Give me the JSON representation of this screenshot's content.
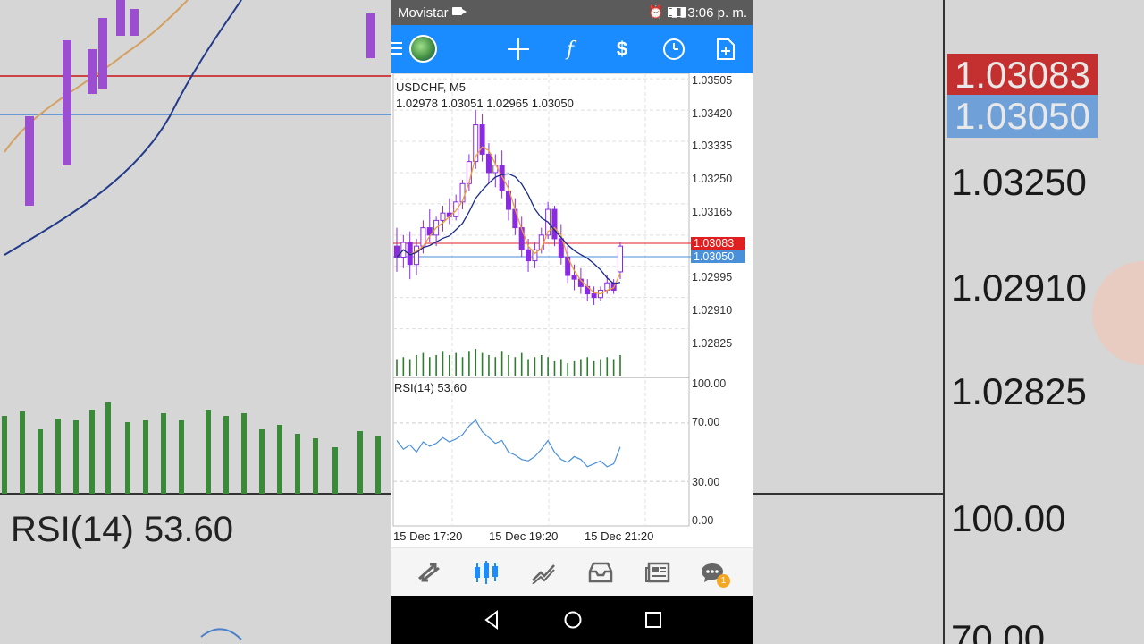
{
  "status_bar": {
    "carrier": "Movistar",
    "indicators": [
      "alarm-icon",
      "signal-icon",
      "battery-icon"
    ],
    "time": "3:06 p. m."
  },
  "toolbar": {
    "items": [
      {
        "name": "crosshair-icon",
        "glyph": "+"
      },
      {
        "name": "indicators-icon",
        "glyph": "f"
      },
      {
        "name": "symbols-icon",
        "glyph": "$"
      },
      {
        "name": "timeframe-icon",
        "glyph": "◷"
      },
      {
        "name": "new-order-icon",
        "glyph": "+"
      }
    ]
  },
  "chart": {
    "symbol": "USDCHF, M5",
    "ohlc": "1.02978 1.03051 1.02965 1.03050",
    "price_axis": [
      "1.03505",
      "1.03420",
      "1.03335",
      "1.03250",
      "1.03165",
      "1.02995",
      "1.02910",
      "1.02825"
    ],
    "ask_price": "1.03083",
    "bid_price": "1.03050",
    "rsi_label": "RSI(14) 53.60",
    "rsi_axis": [
      "100.00",
      "70.00",
      "30.00",
      "0.00"
    ],
    "time_axis": [
      "15 Dec 17:20",
      "15 Dec 19:20",
      "15 Dec 21:20"
    ],
    "colors": {
      "bull": "#8a2be2",
      "bear": "#8a2be2",
      "ma_fast": "#f0a030",
      "ma_slow": "#1a2a8a",
      "ask": "#e02020",
      "bid": "#4a90d9",
      "volume": "#2e7d2e",
      "rsi": "#4a90d9"
    }
  },
  "chart_data": {
    "type": "candlestick",
    "symbol": "USDCHF",
    "timeframe": "M5",
    "ylim": [
      1.0279,
      1.0352
    ],
    "candles": [
      [
        1.0305,
        1.031,
        1.0298,
        1.0302
      ],
      [
        1.0302,
        1.0308,
        1.0299,
        1.0306
      ],
      [
        1.0306,
        1.0309,
        1.0296,
        1.03
      ],
      [
        1.03,
        1.0307,
        1.0297,
        1.0305
      ],
      [
        1.0305,
        1.0312,
        1.0303,
        1.031
      ],
      [
        1.031,
        1.0315,
        1.0306,
        1.0308
      ],
      [
        1.0308,
        1.0313,
        1.0305,
        1.0312
      ],
      [
        1.0312,
        1.0316,
        1.0309,
        1.0314
      ],
      [
        1.0314,
        1.0318,
        1.0311,
        1.0313
      ],
      [
        1.0313,
        1.0319,
        1.0312,
        1.0317
      ],
      [
        1.0317,
        1.0323,
        1.0315,
        1.0322
      ],
      [
        1.0322,
        1.033,
        1.032,
        1.0328
      ],
      [
        1.0328,
        1.0342,
        1.0326,
        1.0338
      ],
      [
        1.0338,
        1.0341,
        1.0328,
        1.033
      ],
      [
        1.033,
        1.0333,
        1.0322,
        1.0325
      ],
      [
        1.0325,
        1.033,
        1.0321,
        1.0327
      ],
      [
        1.0327,
        1.0331,
        1.0318,
        1.032
      ],
      [
        1.032,
        1.0323,
        1.0312,
        1.0315
      ],
      [
        1.0315,
        1.0318,
        1.0308,
        1.031
      ],
      [
        1.031,
        1.0313,
        1.0302,
        1.0304
      ],
      [
        1.0304,
        1.0307,
        1.0298,
        1.0301
      ],
      [
        1.0301,
        1.0306,
        1.0299,
        1.0304
      ],
      [
        1.0304,
        1.031,
        1.0303,
        1.0308
      ],
      [
        1.0308,
        1.0317,
        1.0307,
        1.0315
      ],
      [
        1.0315,
        1.0316,
        1.0305,
        1.0307
      ],
      [
        1.0307,
        1.0311,
        1.03,
        1.0302
      ],
      [
        1.0302,
        1.0305,
        1.0295,
        1.0297
      ],
      [
        1.0297,
        1.03,
        1.0293,
        1.0296
      ],
      [
        1.0296,
        1.0299,
        1.0292,
        1.0294
      ],
      [
        1.0294,
        1.0296,
        1.029,
        1.0292
      ],
      [
        1.0292,
        1.0294,
        1.0289,
        1.0291
      ],
      [
        1.0291,
        1.0294,
        1.029,
        1.0293
      ],
      [
        1.0293,
        1.0297,
        1.0292,
        1.0295
      ],
      [
        1.0295,
        1.0296,
        1.0292,
        1.0293
      ],
      [
        1.0298,
        1.0306,
        1.0296,
        1.0305
      ]
    ],
    "volumes": [
      8,
      9,
      8,
      10,
      11,
      9,
      10,
      12,
      10,
      11,
      9,
      12,
      13,
      11,
      10,
      9,
      12,
      10,
      9,
      11,
      8,
      9,
      10,
      9,
      7,
      8,
      6,
      7,
      8,
      9,
      7,
      8,
      9,
      8,
      10
    ],
    "rsi": [
      58,
      52,
      55,
      50,
      57,
      54,
      56,
      60,
      57,
      59,
      62,
      68,
      72,
      64,
      60,
      56,
      58,
      50,
      48,
      45,
      44,
      47,
      52,
      58,
      50,
      45,
      43,
      47,
      45,
      40,
      42,
      44,
      40,
      42,
      53.6
    ]
  }
}
